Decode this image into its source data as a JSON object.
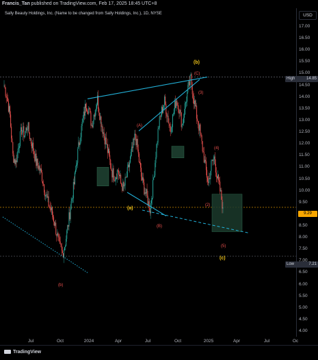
{
  "header": {
    "author": "Francis_Tan",
    "published": "published on TradingView.com, Feb 17, 2025 18:45 UTC+8"
  },
  "symbol": {
    "title": "Sally Beauty Holdings, Inc. (Name to be changed from Sally Holdings, Inc.), 1D, NYSE"
  },
  "price_axis": {
    "currency": "USD",
    "ticks": [
      "17.00",
      "16.50",
      "16.00",
      "15.50",
      "15.00",
      "14.50",
      "14.00",
      "13.50",
      "13.00",
      "12.50",
      "12.00",
      "11.50",
      "11.00",
      "10.50",
      "10.00",
      "9.50",
      "9.00",
      "8.50",
      "8.00",
      "7.50",
      "7.00",
      "6.50",
      "6.00",
      "5.50",
      "5.00",
      "4.50",
      "4.00"
    ]
  },
  "time_axis": {
    "labels": [
      "Jul",
      "Oct",
      "2024",
      "Apr",
      "Jul",
      "Oct",
      "2025",
      "Apr",
      "Jul",
      "Oc"
    ]
  },
  "badges": {
    "high_label": "High",
    "high_value": "14.85",
    "last_value": "9.29",
    "low_label": "Low",
    "low_value": "7.21"
  },
  "waves": {
    "b_big": "(b)",
    "c_big": "(c)",
    "a_big": "(a)",
    "b_red_low": "(b)",
    "w4": "(4)",
    "w5": "(5)",
    "wC": "(C)",
    "wA": "(A)",
    "wB": "(B)",
    "w3": "(3)",
    "w4b": "(4)",
    "w2": "(2)",
    "w5b": "(5)"
  },
  "footer": {
    "brand": "TradingView"
  },
  "colors": {
    "up": "#26a69a",
    "down": "#ef5350",
    "trendline": "#22b0d8",
    "wave_major": "#f0c419",
    "wave_minor": "#ef5350",
    "zone_fill": "#1b3a2c"
  },
  "chart_data": {
    "type": "candlestick",
    "title": "Sally Beauty Holdings, Inc. (Name to be changed from Sally Holdings, Inc.), 1D, NYSE",
    "ylim": [
      3.5,
      17.5
    ],
    "x_range": [
      "2023-05",
      "2025-10"
    ],
    "high": 14.85,
    "low": 7.21,
    "last": 9.29,
    "closes": [
      14.5,
      14.0,
      13.2,
      11.5,
      11.2,
      12.0,
      12.6,
      12.4,
      12.8,
      12.2,
      11.8,
      11.2,
      11.0,
      10.6,
      10.0,
      9.5,
      9.2,
      8.8,
      8.2,
      7.6,
      7.3,
      7.8,
      8.6,
      9.5,
      10.3,
      11.4,
      12.3,
      13.0,
      13.7,
      13.5,
      12.8,
      13.4,
      13.9,
      13.1,
      12.5,
      12.0,
      11.4,
      10.8,
      10.6,
      10.9,
      10.3,
      10.1,
      10.6,
      11.2,
      11.8,
      12.4,
      11.5,
      10.6,
      10.1,
      9.7,
      9.2,
      10.2,
      11.6,
      12.8,
      13.4,
      13.8,
      13.2,
      12.6,
      13.3,
      13.9,
      13.5,
      12.8,
      13.6,
      14.3,
      14.8,
      13.9,
      13.2,
      12.6,
      11.8,
      11.0,
      10.3,
      11.1,
      11.4,
      10.6,
      10.0,
      9.29
    ]
  }
}
